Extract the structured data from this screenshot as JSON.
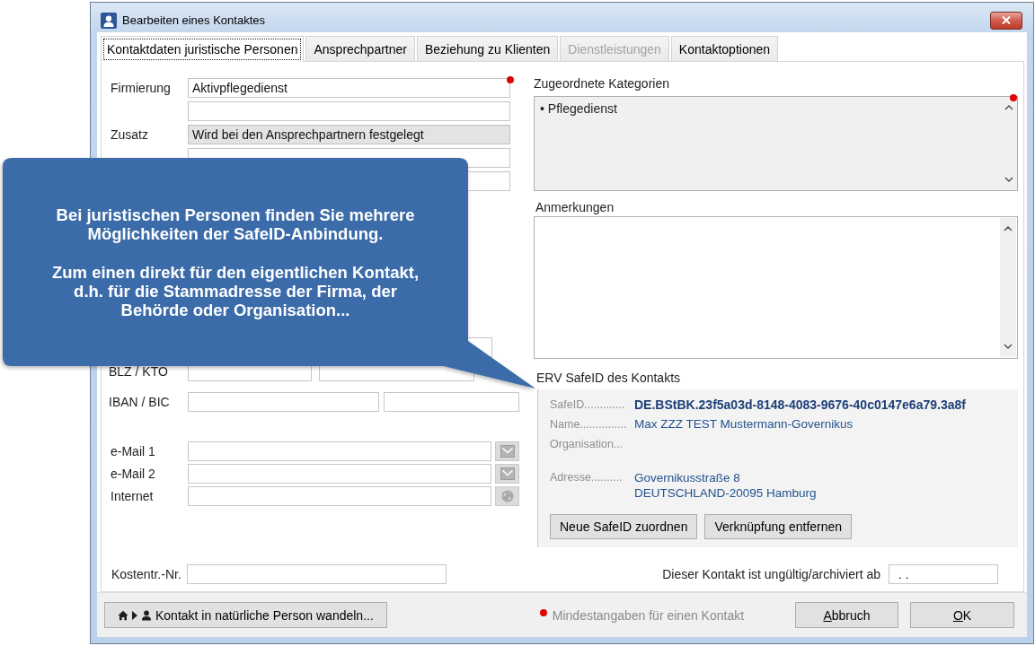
{
  "window": {
    "title": "Bearbeiten eines Kontaktes"
  },
  "tabs": [
    {
      "label": "Kontaktdaten juristische Personen",
      "selected": true,
      "disabled": false
    },
    {
      "label": "Ansprechpartner",
      "selected": false,
      "disabled": false
    },
    {
      "label": "Beziehung zu Klienten",
      "selected": false,
      "disabled": false
    },
    {
      "label": "Dienstleistungen",
      "selected": false,
      "disabled": true
    },
    {
      "label": "Kontaktoptionen",
      "selected": false,
      "disabled": false
    }
  ],
  "form": {
    "groups": [
      [
        {
          "kind": "text",
          "label": "Firmierung",
          "value": "Aktivpflegedienst",
          "required": true,
          "disabled": false
        },
        {
          "kind": "text",
          "required": false,
          "disabled": false
        },
        {
          "kind": "text",
          "label": "Zusatz",
          "value": "Wird bei den Ansprechpartnern festgelegt",
          "required": false,
          "disabled": true
        },
        {
          "kind": "text",
          "required": false,
          "disabled": false
        },
        {
          "kind": "text",
          "required": false,
          "disabled": false
        }
      ],
      [
        {
          "kind": "short",
          "required": false,
          "disabled": false
        },
        {
          "kind": "blz",
          "label": "BLZ / KTO",
          "required": false,
          "disabled": false
        }
      ],
      [
        {
          "kind": "iban",
          "label": "IBAN / BIC",
          "required": false,
          "disabled": false
        }
      ],
      [
        {
          "kind": "email",
          "label": "e-Mail 1",
          "required": false,
          "disabled": false,
          "action_disabled": true
        },
        {
          "kind": "email",
          "label": "e-Mail 2",
          "required": false,
          "disabled": false,
          "action_disabled": true
        },
        {
          "kind": "web",
          "label": "Internet",
          "required": false,
          "disabled": false,
          "action_disabled": true
        }
      ]
    ]
  },
  "categories": {
    "label": "Zugeordnete Kategorien",
    "required": true,
    "disabled": true,
    "items": [
      "• Pflegedienst"
    ]
  },
  "notes": {
    "label": "Anmerkungen"
  },
  "safeid": {
    "title": "ERV SafeID des Kontakts",
    "rows": [
      {
        "kind": "id",
        "label": "SafeID.............",
        "lines": [
          "DE.BStBK.23f5a03d-8148-4083-9676-40c0147e6a79.3a8f"
        ]
      },
      {
        "kind": "plain",
        "label": "Name...............",
        "lines": [
          "Max ZZZ TEST Mustermann-Governikus"
        ]
      },
      {
        "kind": "plain",
        "label": "Organisation..."
      },
      {
        "kind": "address",
        "label": "Adresse..........",
        "lines": [
          "Governikusstraße 8",
          "DEUTSCHLAND-20095 Hamburg"
        ]
      }
    ],
    "buttons": [
      "Neue SafeID zuordnen",
      "Verknüpfung entfernen"
    ]
  },
  "cost_center": {
    "label": "Kostentr.-Nr."
  },
  "archive": {
    "label": "Dieser Kontakt ist ungültig/archiviert ab",
    "value": ". ."
  },
  "footer": {
    "convert_button": "Kontakt in natürliche Person wandeln...",
    "legend": "Mindestangaben für einen Kontakt",
    "buttons": [
      {
        "label": "Abbruch",
        "mnemonic": true
      },
      {
        "label": "OK",
        "mnemonic": true
      }
    ]
  },
  "callout": {
    "paragraphs": [
      "Bei juristischen Personen finden Sie mehrere Möglichkeiten der SafeID-Anbindung.",
      "Zum einen direkt für den eigentlichen Kontakt, d.h. für die Stammadresse der Firma, der Behörde oder Organisation..."
    ]
  }
}
